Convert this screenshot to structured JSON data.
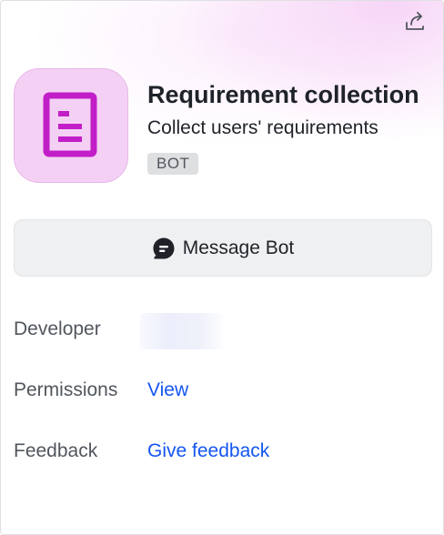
{
  "header": {
    "share_icon": "share-icon",
    "avatar_icon": "document-icon",
    "title": "Requirement collection",
    "subtitle": "Collect users' requirements",
    "badge": "BOT"
  },
  "actions": {
    "message_icon": "chat-bubble-icon",
    "message_label": "Message Bot"
  },
  "details": {
    "developer_label": "Developer",
    "developer_value": "",
    "permissions_label": "Permissions",
    "permissions_link": "View",
    "feedback_label": "Feedback",
    "feedback_link": "Give feedback"
  },
  "colors": {
    "accent_magenta": "#c21ec8",
    "avatar_bg": "#f4d1f4",
    "link_blue": "#1456f0",
    "button_bg": "#eff0f1",
    "badge_bg": "#dedfe1"
  }
}
